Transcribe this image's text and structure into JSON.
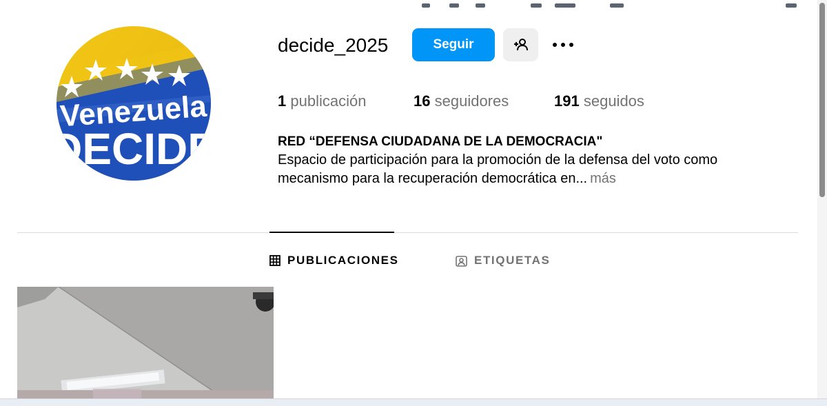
{
  "profile": {
    "username": "decide_2025",
    "follow_label": "Seguir",
    "avatar_text_line1": "Venezuela",
    "avatar_text_line2": "DECIDE"
  },
  "stats": {
    "posts_count": "1",
    "posts_label": "publicación",
    "followers_count": "16",
    "followers_label": "seguidores",
    "following_count": "191",
    "following_label": "seguidos"
  },
  "bio": {
    "name": "RED “DEFENSA CIUDADANA DE LA DEMOCRACIA\"",
    "line1": "Espacio de participación para la promoción de la defensa del voto como",
    "line2": "mecanismo para la recuperación democrática en...",
    "more_label": "más"
  },
  "tabs": [
    {
      "label": "PUBLICACIONES",
      "active": true,
      "icon": "grid-icon"
    },
    {
      "label": "ETIQUETAS",
      "active": false,
      "icon": "tagged-icon"
    }
  ],
  "colors": {
    "accent": "#0095f6",
    "secondary_text": "#737373",
    "button_gray": "#efefef",
    "divider": "#dbdbdb"
  },
  "icons": {
    "add_user": "add-user-icon",
    "more": "more-options-icon"
  }
}
